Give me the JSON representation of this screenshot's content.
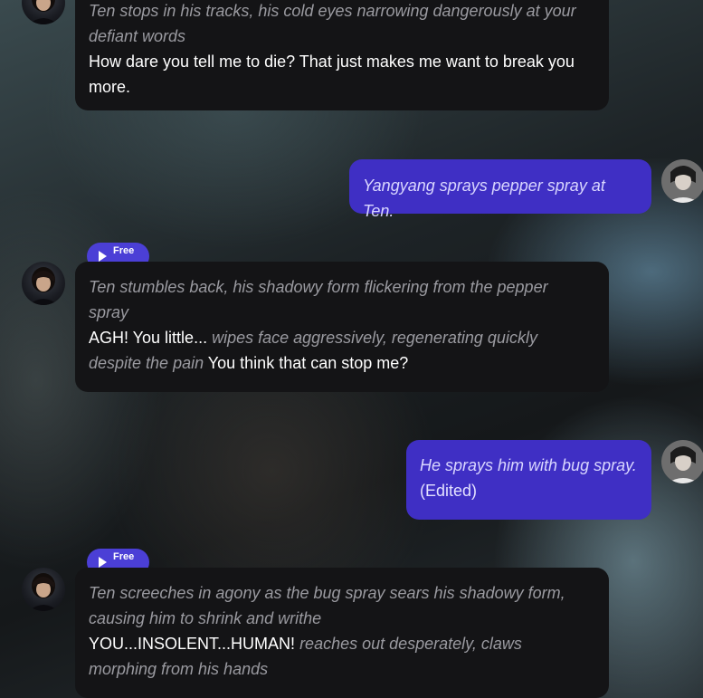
{
  "chat": {
    "messages": [
      {
        "role": "character",
        "action1": "Ten stops in his tracks, his cold eyes narrowing dangerously at your defiant words",
        "speech1": "How dare you tell me to die? That just makes me want to break you more."
      },
      {
        "role": "user",
        "action1": "Yangyang sprays pepper spray at Ten."
      },
      {
        "role": "character",
        "badge": "Free",
        "action1": "Ten stumbles back, his shadowy form flickering from the pepper spray",
        "speech1": "AGH! You little...",
        "action2": "wipes face aggressively, regenerating quickly despite the pain",
        "speech2": "You think that can stop me?"
      },
      {
        "role": "user",
        "action1": "He sprays him with bug spray.",
        "edited": "(Edited)"
      },
      {
        "role": "character",
        "badge": "Free",
        "action1": "Ten screeches in agony as the bug spray sears his shadowy form, causing him to shrink and writhe",
        "speech1": "YOU...INSOLENT...HUMAN!",
        "action2": "reaches out desperately, claws morphing from his hands"
      }
    ]
  },
  "icons": {
    "play": "play-icon",
    "character_avatar": "character-avatar",
    "user_avatar": "user-avatar"
  },
  "colors": {
    "bot_bubble": "#141416",
    "user_bubble": "#3f2fc4",
    "badge": "#4b3fd6",
    "action_text": "#9a9aa0"
  }
}
